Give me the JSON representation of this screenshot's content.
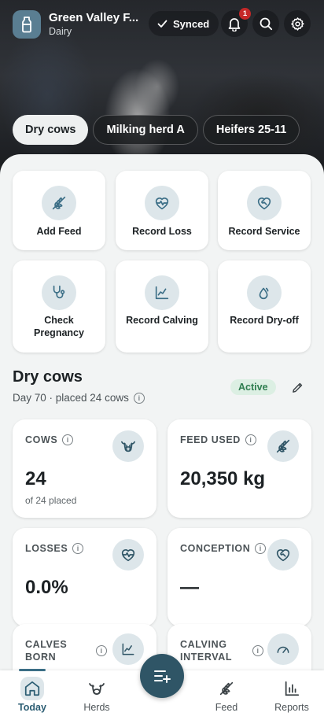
{
  "header": {
    "farm_name": "Green Valley F...",
    "farm_type": "Dairy",
    "sync_label": "Synced",
    "notification_count": "1"
  },
  "groups": [
    {
      "label": "Dry cows",
      "selected": true
    },
    {
      "label": "Milking herd A",
      "selected": false
    },
    {
      "label": "Heifers 25-11",
      "selected": false
    }
  ],
  "actions": [
    {
      "label": "Add Feed",
      "icon": "feed-icon"
    },
    {
      "label": "Record Loss",
      "icon": "heart-pulse-icon"
    },
    {
      "label": "Record Service",
      "icon": "heart-handshake-icon"
    },
    {
      "label": "Check Pregnancy",
      "icon": "stethoscope-icon"
    },
    {
      "label": "Record Calving",
      "icon": "chart-line-icon"
    },
    {
      "label": "Record Dry-off",
      "icon": "droplets-icon"
    }
  ],
  "group_summary": {
    "title": "Dry cows",
    "subtitle": "Day 70 · placed 24 cows",
    "status": "Active"
  },
  "stats": [
    {
      "label": "COWS",
      "value": "24",
      "note": "of 24 placed",
      "icon": "cow-icon"
    },
    {
      "label": "FEED USED",
      "value": "20,350 kg",
      "note": "",
      "icon": "feed-icon"
    },
    {
      "label": "LOSSES",
      "value": "0.0%",
      "note": "",
      "icon": "heart-pulse-icon"
    },
    {
      "label": "CONCEPTION",
      "value": "—",
      "note": "",
      "icon": "heart-handshake-icon"
    },
    {
      "label": "CALVES BORN",
      "value": "",
      "note": "",
      "icon": "chart-line-icon"
    },
    {
      "label": "CALVING INTERVAL",
      "value": "",
      "note": "",
      "icon": "gauge-icon"
    }
  ],
  "nav": [
    {
      "label": "Today",
      "active": true
    },
    {
      "label": "Herds",
      "active": false
    },
    {
      "label": "Feed",
      "active": false
    },
    {
      "label": "Reports",
      "active": false
    }
  ],
  "colors": {
    "accent": "#2f5566",
    "active_status_bg": "#dcefe3",
    "active_status_text": "#2e7d4f",
    "notification_badge": "#c62828"
  }
}
